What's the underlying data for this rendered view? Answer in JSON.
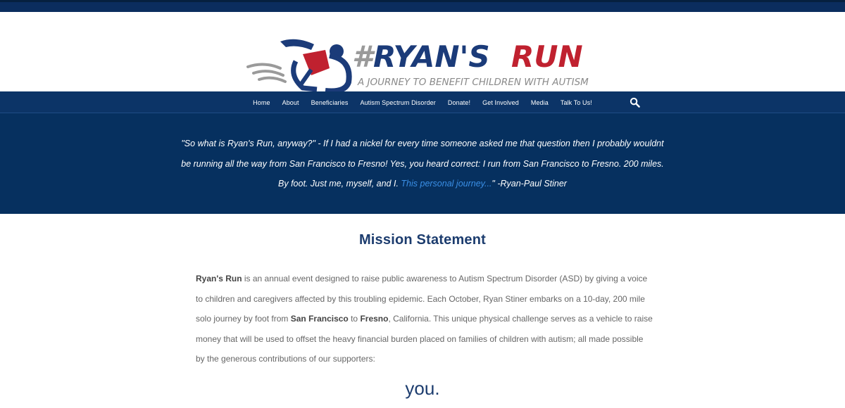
{
  "logo": {
    "hashtag": "#",
    "name_part1": "RYAN'S",
    "name_part2": "RUN",
    "tagline": "A JOURNEY TO BENEFIT CHILDREN WITH AUTISM",
    "colors": {
      "navy": "#1b3b79",
      "red": "#c0212f",
      "gray": "#9a9a9a"
    }
  },
  "nav": {
    "items": [
      {
        "label": "Home"
      },
      {
        "label": "About"
      },
      {
        "label": "Beneficiaries"
      },
      {
        "label": "Autism Spectrum Disorder"
      },
      {
        "label": "Donate!"
      },
      {
        "label": "Get Involved"
      },
      {
        "label": "Media"
      },
      {
        "label": "Talk To Us!"
      }
    ],
    "search_icon": "search-icon"
  },
  "hero": {
    "quote_text": "\"So what is Ryan's Run, anyway?\" - If I had a nickel for every time someone asked me that question then I probably wouldnt be running all the way from San Francisco to Fresno! Yes, you heard correct: I run from San Francisco to Fresno. 200 miles. By foot. Just me, myself, and I.",
    "link_text": "This personal journey...",
    "after_link": "\" -Ryan-Paul Stiner"
  },
  "mission": {
    "title": "Mission Statement",
    "b1": "Ryan's Run",
    "t1": " is an annual event designed to raise public awareness to Autism Spectrum Disorder (ASD) by giving a voice to children and caregivers affected by this troubling epidemic. Each October, Ryan Stiner embarks on a 10-day, 200 mile solo journey by foot from ",
    "b2": "San Francisco",
    "t2": " to ",
    "b3": "Fresno",
    "t3": ", California. This unique physical challenge serves as a vehicle to raise money that will be used to offset the heavy financial burden placed on families of children with autism; all made possible by the generous contributions of our supporters:",
    "you": "you."
  },
  "colors": {
    "topbar": "#0b2d5e",
    "nav_bg": "#0c3467",
    "hero_bg": "#06305f",
    "link": "#3a8fe6",
    "heading": "#1c3c6e"
  }
}
